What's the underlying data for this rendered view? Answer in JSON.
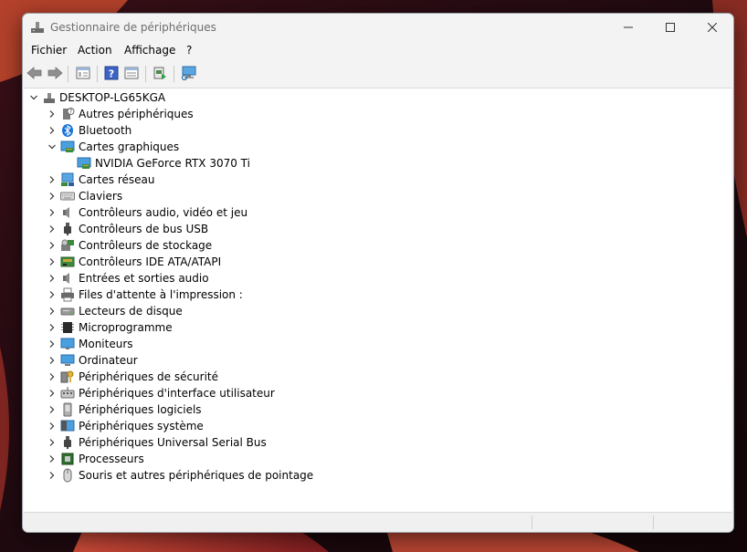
{
  "window": {
    "title": "Gestionnaire de périphériques"
  },
  "menu": [
    "Fichier",
    "Action",
    "Affichage",
    "?"
  ],
  "toolbar": {
    "buttons": [
      "back-arrow-icon",
      "forward-arrow-icon",
      "properties-icon",
      "help-icon",
      "view-icon",
      "update-driver-icon",
      "scan-hardware-icon"
    ]
  },
  "tree": {
    "root": "DESKTOP-LG65KGA",
    "categories": [
      {
        "label": "Autres périphériques",
        "icon": "unknown-device-icon",
        "expanded": false
      },
      {
        "label": "Bluetooth",
        "icon": "bluetooth-icon",
        "expanded": false
      },
      {
        "label": "Cartes graphiques",
        "icon": "display-adapter-icon",
        "expanded": true,
        "children": [
          "NVIDIA GeForce RTX 3070 Ti"
        ]
      },
      {
        "label": "Cartes réseau",
        "icon": "network-adapter-icon",
        "expanded": false
      },
      {
        "label": "Claviers",
        "icon": "keyboard-icon",
        "expanded": false
      },
      {
        "label": "Contrôleurs audio, vidéo et jeu",
        "icon": "speaker-icon",
        "expanded": false
      },
      {
        "label": "Contrôleurs de bus USB",
        "icon": "usb-icon",
        "expanded": false
      },
      {
        "label": "Contrôleurs de stockage",
        "icon": "storage-controller-icon",
        "expanded": false
      },
      {
        "label": "Contrôleurs IDE ATA/ATAPI",
        "icon": "ide-controller-icon",
        "expanded": false
      },
      {
        "label": "Entrées et sorties audio",
        "icon": "speaker-icon",
        "expanded": false
      },
      {
        "label": "Files d'attente à l'impression :",
        "icon": "printer-icon",
        "expanded": false
      },
      {
        "label": "Lecteurs de disque",
        "icon": "disk-drive-icon",
        "expanded": false
      },
      {
        "label": "Microprogramme",
        "icon": "firmware-icon",
        "expanded": false
      },
      {
        "label": "Moniteurs",
        "icon": "monitor-icon",
        "expanded": false
      },
      {
        "label": "Ordinateur",
        "icon": "computer-icon",
        "expanded": false
      },
      {
        "label": "Périphériques de sécurité",
        "icon": "security-key-icon",
        "expanded": false
      },
      {
        "label": "Périphériques d'interface utilisateur",
        "icon": "hid-icon",
        "expanded": false
      },
      {
        "label": "Périphériques logiciels",
        "icon": "software-device-icon",
        "expanded": false
      },
      {
        "label": "Périphériques système",
        "icon": "system-device-icon",
        "expanded": false
      },
      {
        "label": "Périphériques Universal Serial Bus",
        "icon": "usb-icon",
        "expanded": false
      },
      {
        "label": "Processeurs",
        "icon": "processor-icon",
        "expanded": false
      },
      {
        "label": "Souris et autres périphériques de pointage",
        "icon": "mouse-icon",
        "expanded": false
      }
    ]
  },
  "colors": {
    "window_bg": "#f3f3f3",
    "tree_bg": "#ffffff",
    "title_text": "#6d6d6d",
    "accent_blue": "#2b79d6",
    "wallpaper_red": "#c0392b"
  }
}
